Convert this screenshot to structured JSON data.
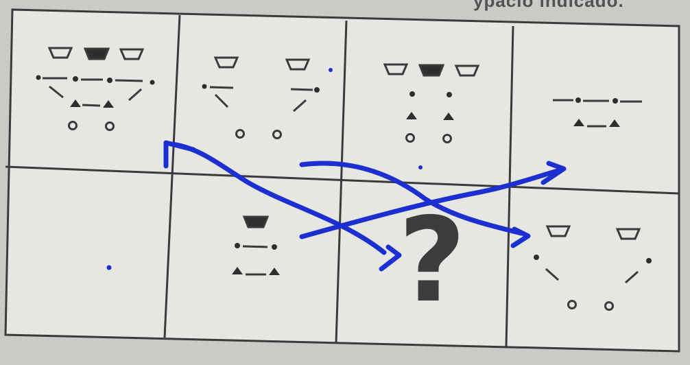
{
  "header": {
    "partial_text": "ypacio indicado."
  },
  "puzzle": {
    "missing_mark": "?"
  },
  "colors": {
    "ink": "#3b3b3b",
    "annotation": "#1c2fd0",
    "paper": "#e6e6e3"
  },
  "icons": [
    "trapezoid-outline-icon",
    "trapezoid-filled-icon",
    "dot-icon",
    "triangle-icon",
    "circle-outline-icon",
    "question-mark-icon",
    "curved-arrow-icon"
  ]
}
